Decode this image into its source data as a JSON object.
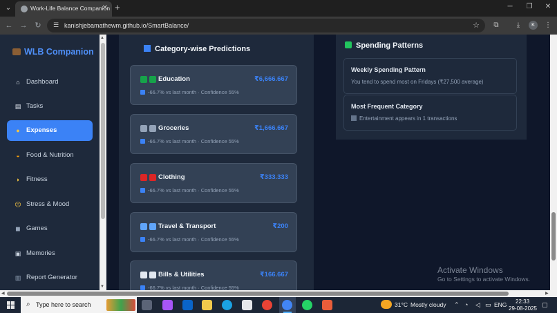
{
  "browser": {
    "tab_title": "Work-Life Balance Companion",
    "url": "kanishjebamathewm.github.io/SmartBalance/",
    "profile_initial": "K"
  },
  "app": {
    "brand": "WLB Companion",
    "accent_color": "#3b82f6",
    "nav": [
      {
        "label": "Dashboard",
        "icon": "home-icon"
      },
      {
        "label": "Tasks",
        "icon": "clipboard-icon"
      },
      {
        "label": "Expenses",
        "icon": "money-bag-icon",
        "active": true
      },
      {
        "label": "Food & Nutrition",
        "icon": "food-icon"
      },
      {
        "label": "Fitness",
        "icon": "flexed-arm-icon"
      },
      {
        "label": "Stress & Mood",
        "icon": "face-icon"
      },
      {
        "label": "Games",
        "icon": "game-controller-icon"
      },
      {
        "label": "Memories",
        "icon": "memories-icon"
      },
      {
        "label": "Report Generator",
        "icon": "report-icon"
      }
    ]
  },
  "predictions": {
    "title": "Category-wise Predictions",
    "items": [
      {
        "name": "Education",
        "amount": "₹6,666.667",
        "trend": "-66.7% vs last month · Confidence 55%"
      },
      {
        "name": "Groceries",
        "amount": "₹1,666.667",
        "trend": "-66.7% vs last month · Confidence 55%"
      },
      {
        "name": "Clothing",
        "amount": "₹333.333",
        "trend": "-66.7% vs last month · Confidence 55%"
      },
      {
        "name": "Travel & Transport",
        "amount": "₹200",
        "trend": "-66.7% vs last month · Confidence 55%"
      },
      {
        "name": "Bills & Utilities",
        "amount": "₹166.667",
        "trend": "-66.7% vs last month · Confidence 55%"
      }
    ]
  },
  "spending": {
    "title": "Spending Patterns",
    "cards": [
      {
        "title": "Weekly Spending Pattern",
        "desc": "You tend to spend most on Fridays (₹27,500 average)"
      },
      {
        "title": "Most Frequent Category",
        "desc": "Entertainment appears in 1 transactions"
      }
    ]
  },
  "watermark": {
    "line1": "Activate Windows",
    "line2": "Go to Settings to activate Windows."
  },
  "taskbar": {
    "search_placeholder": "Type here to search",
    "temperature": "31°C",
    "weather": "Mostly cloudy",
    "language": "ENG",
    "time": "22:33",
    "date": "29-08-2025"
  }
}
